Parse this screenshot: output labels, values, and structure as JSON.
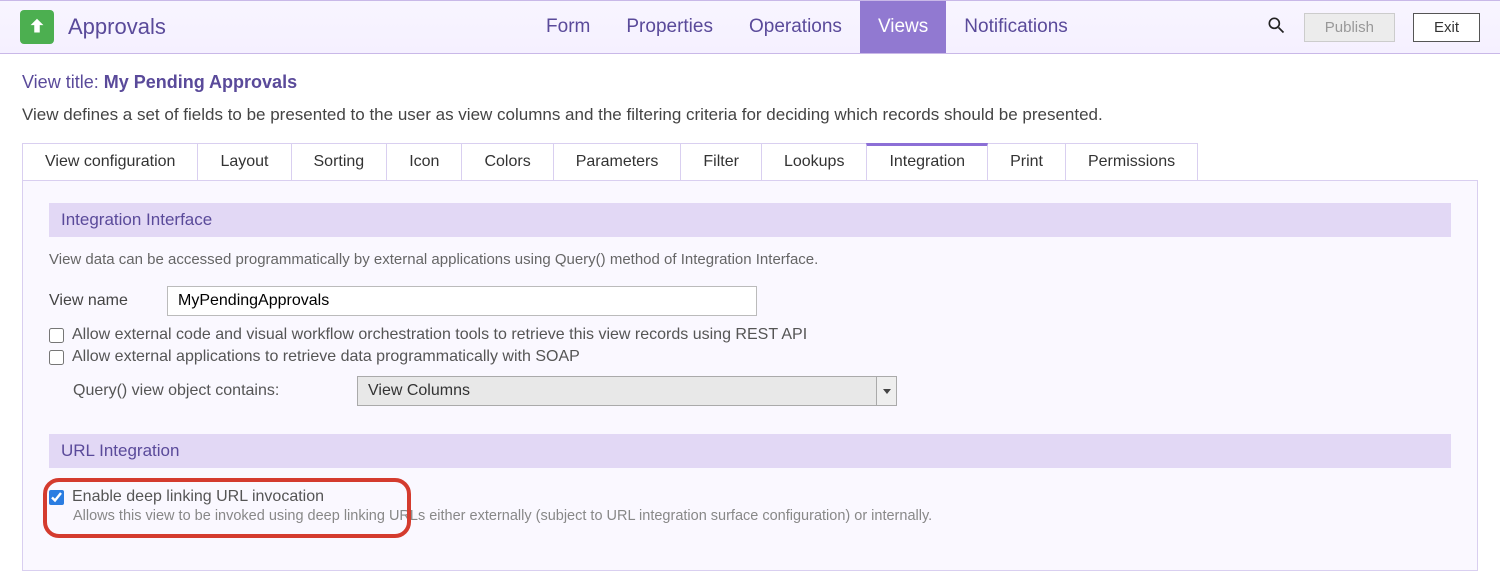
{
  "app": {
    "title": "Approvals"
  },
  "topnav": {
    "items": [
      {
        "label": "Form"
      },
      {
        "label": "Properties"
      },
      {
        "label": "Operations"
      },
      {
        "label": "Views"
      },
      {
        "label": "Notifications"
      }
    ],
    "active_index": 3
  },
  "actions": {
    "publish_label": "Publish",
    "exit_label": "Exit"
  },
  "view": {
    "title_prefix": "View title:",
    "title_value": "My Pending Approvals",
    "description": "View defines a set of fields to be presented to the user as view columns and the filtering criteria for deciding which records should be presented."
  },
  "subtabs": {
    "items": [
      "View configuration",
      "Layout",
      "Sorting",
      "Icon",
      "Colors",
      "Parameters",
      "Filter",
      "Lookups",
      "Integration",
      "Print",
      "Permissions"
    ],
    "active_index": 8
  },
  "integration": {
    "section_title": "Integration Interface",
    "section_desc": "View data can be accessed programmatically by external applications using Query() method of Integration Interface.",
    "view_name_label": "View name",
    "view_name_value": "MyPendingApprovals",
    "checkbox_rest": {
      "checked": false,
      "label": "Allow external code and visual workflow orchestration tools to retrieve this view records using REST API"
    },
    "checkbox_soap": {
      "checked": false,
      "label": "Allow external applications to retrieve data programmatically with SOAP"
    },
    "query_label": "Query() view object contains:",
    "query_value": "View Columns"
  },
  "url_integration": {
    "section_title": "URL Integration",
    "checkbox": {
      "checked": true,
      "label": "Enable deep linking URL invocation"
    },
    "subtext": "Allows this view to be invoked using deep linking URLs either externally (subject to URL integration surface configuration) or internally."
  }
}
